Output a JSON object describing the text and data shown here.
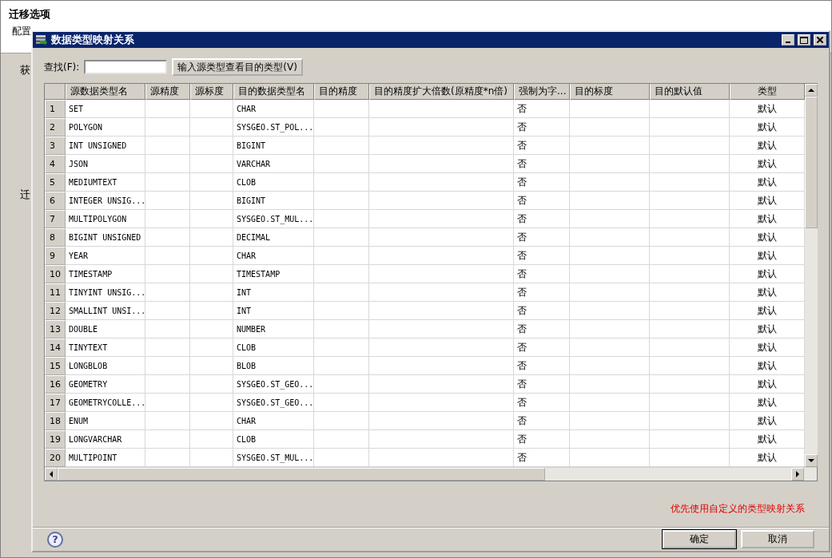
{
  "page": {
    "title": "迁移选项",
    "subtitle": "配置",
    "label_1": "获",
    "label_2": "迁"
  },
  "dialog": {
    "title": "数据类型映射关系",
    "search": {
      "label": "查找(F):",
      "button": "输入源类型查看目的类型(V)"
    },
    "table": {
      "columns": [
        "源数据类型名",
        "源精度",
        "源标度",
        "目的数据类型名",
        "目的精度",
        "目的精度扩大倍数(原精度*n倍)",
        "强制为字...",
        "目的标度",
        "目的默认值",
        "类型"
      ],
      "rows": [
        {
          "number": "1",
          "source_type": "SET",
          "target_type": "CHAR",
          "force_char": "否",
          "type": "默认"
        },
        {
          "number": "2",
          "source_type": "POLYGON",
          "target_type": "SYSGEO.ST_POL...",
          "force_char": "否",
          "type": "默认"
        },
        {
          "number": "3",
          "source_type": "INT UNSIGNED",
          "target_type": "BIGINT",
          "force_char": "否",
          "type": "默认"
        },
        {
          "number": "4",
          "source_type": "JSON",
          "target_type": "VARCHAR",
          "force_char": "否",
          "type": "默认"
        },
        {
          "number": "5",
          "source_type": "MEDIUMTEXT",
          "target_type": "CLOB",
          "force_char": "否",
          "type": "默认"
        },
        {
          "number": "6",
          "source_type": "INTEGER UNSIG...",
          "target_type": "BIGINT",
          "force_char": "否",
          "type": "默认"
        },
        {
          "number": "7",
          "source_type": "MULTIPOLYGON",
          "target_type": "SYSGEO.ST_MUL...",
          "force_char": "否",
          "type": "默认"
        },
        {
          "number": "8",
          "source_type": "BIGINT UNSIGNED",
          "target_type": "DECIMAL",
          "force_char": "否",
          "type": "默认"
        },
        {
          "number": "9",
          "source_type": "YEAR",
          "target_type": "CHAR",
          "force_char": "否",
          "type": "默认"
        },
        {
          "number": "10",
          "source_type": "TIMESTAMP",
          "target_type": "TIMESTAMP",
          "force_char": "否",
          "type": "默认"
        },
        {
          "number": "11",
          "source_type": "TINYINT UNSIG...",
          "target_type": "INT",
          "force_char": "否",
          "type": "默认"
        },
        {
          "number": "12",
          "source_type": "SMALLINT UNSI...",
          "target_type": "INT",
          "force_char": "否",
          "type": "默认"
        },
        {
          "number": "13",
          "source_type": "DOUBLE",
          "target_type": "NUMBER",
          "force_char": "否",
          "type": "默认"
        },
        {
          "number": "14",
          "source_type": "TINYTEXT",
          "target_type": "CLOB",
          "force_char": "否",
          "type": "默认"
        },
        {
          "number": "15",
          "source_type": "LONGBLOB",
          "target_type": "BLOB",
          "force_char": "否",
          "type": "默认"
        },
        {
          "number": "16",
          "source_type": "GEOMETRY",
          "target_type": "SYSGEO.ST_GEO...",
          "force_char": "否",
          "type": "默认"
        },
        {
          "number": "17",
          "source_type": "GEOMETRYCOLLE...",
          "target_type": "SYSGEO.ST_GEO...",
          "force_char": "否",
          "type": "默认"
        },
        {
          "number": "18",
          "source_type": "ENUM",
          "target_type": "CHAR",
          "force_char": "否",
          "type": "默认"
        },
        {
          "number": "19",
          "source_type": "LONGVARCHAR",
          "target_type": "CLOB",
          "force_char": "否",
          "type": "默认"
        },
        {
          "number": "20",
          "source_type": "MULTIPOINT",
          "target_type": "SYSGEO.ST_MUL...",
          "force_char": "否",
          "type": "默认"
        }
      ]
    },
    "note": "优先使用自定义的类型映射关系",
    "help": "?",
    "buttons": [
      "确定",
      "取消"
    ]
  }
}
